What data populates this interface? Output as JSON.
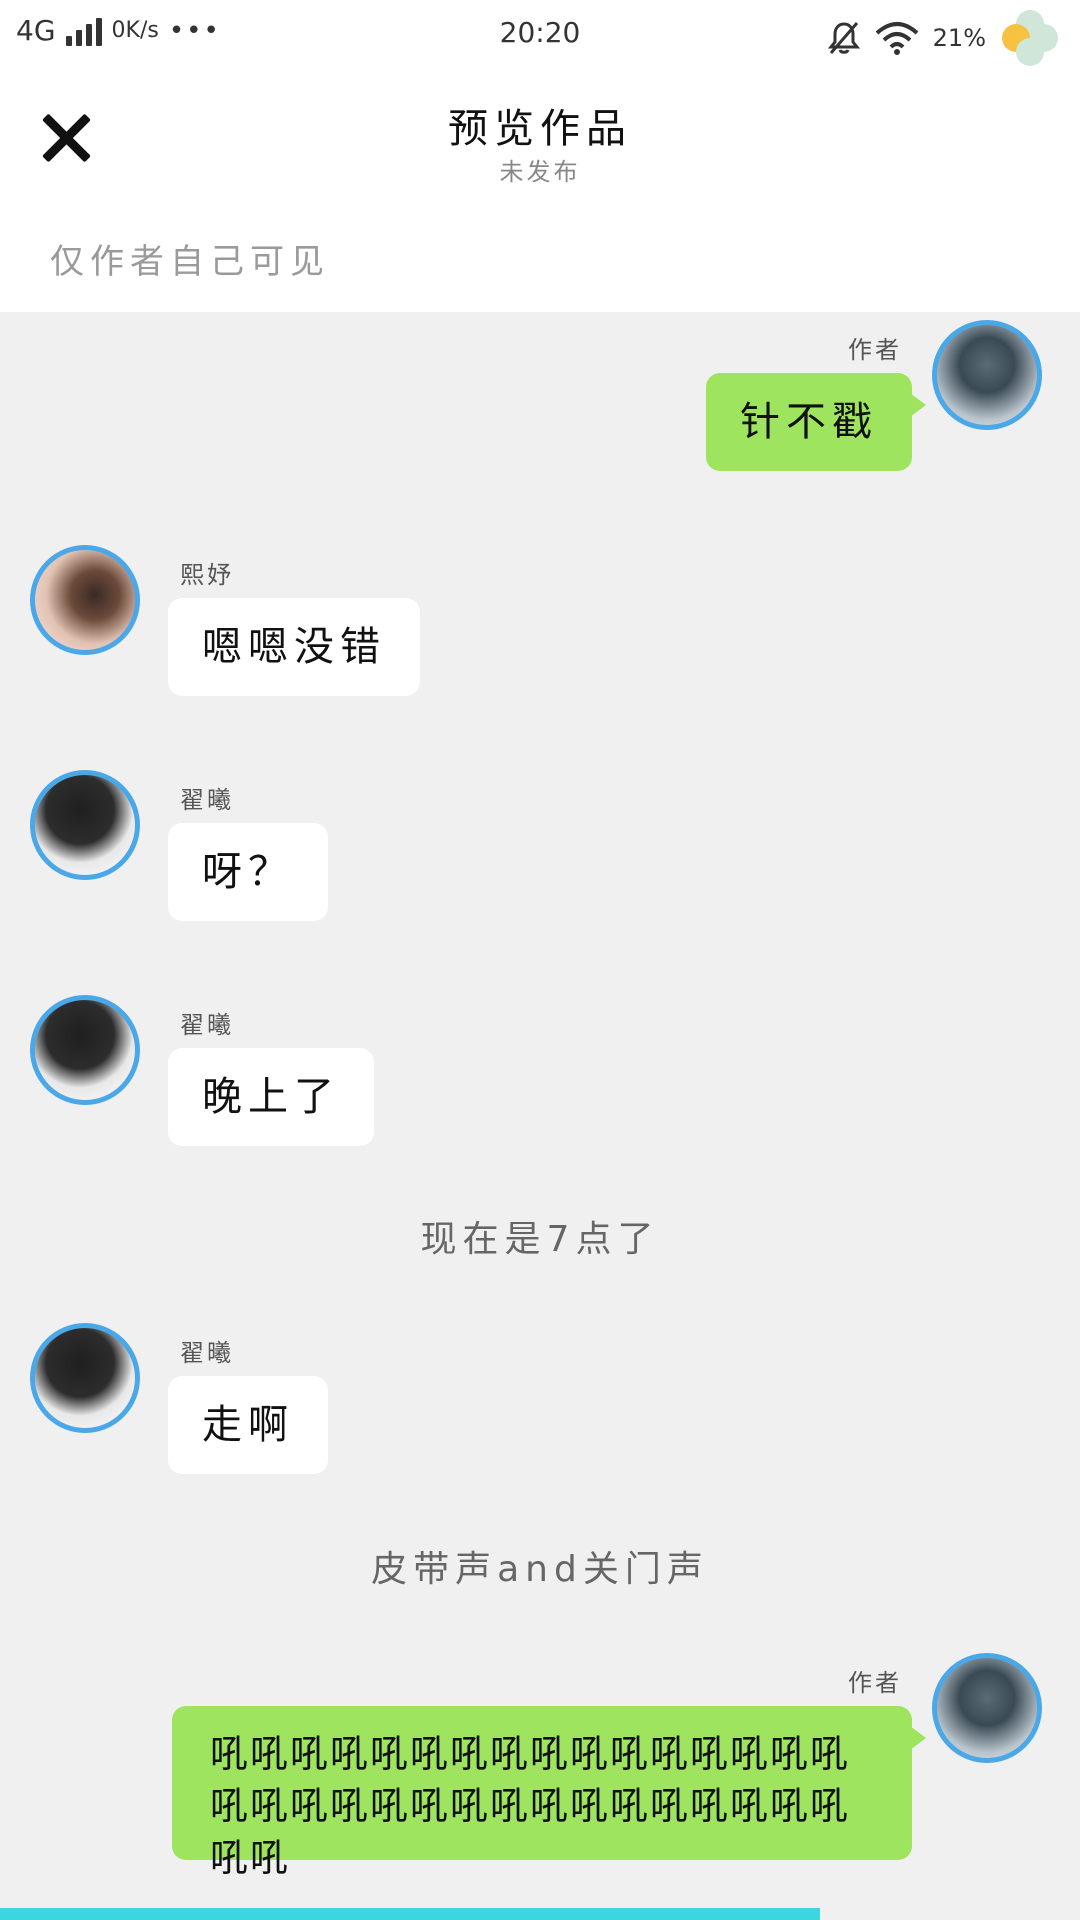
{
  "status_bar": {
    "network": "4G",
    "speed": "0K/s",
    "dots": "•••",
    "time": "20:20",
    "battery": "21%"
  },
  "header": {
    "title": "预览作品",
    "subtitle": "未发布"
  },
  "visibility_note": "仅作者自己可见",
  "messages": [
    {
      "sender": "作者",
      "text": "针不戳",
      "side": "right"
    },
    {
      "sender": "熙妤",
      "text": "嗯嗯没错",
      "side": "left"
    },
    {
      "sender": "翟曦",
      "text": "呀？",
      "side": "left"
    },
    {
      "sender": "翟曦",
      "text": "晚上了",
      "side": "left"
    },
    {
      "narration": "现在是7点了"
    },
    {
      "sender": "翟曦",
      "text": "走啊",
      "side": "left"
    },
    {
      "narration": "皮带声and关门声"
    },
    {
      "sender": "作者",
      "text": "吼吼吼吼吼吼吼吼吼吼吼吼吼吼吼吼吼吼吼吼吼吼吼吼吼吼吼吼吼吼吼吼吼吼",
      "side": "right"
    }
  ],
  "colors": {
    "accent_blue": "#4aa8e8",
    "bubble_green": "#9fe45e",
    "progress_cyan": "#3bd6e0"
  }
}
